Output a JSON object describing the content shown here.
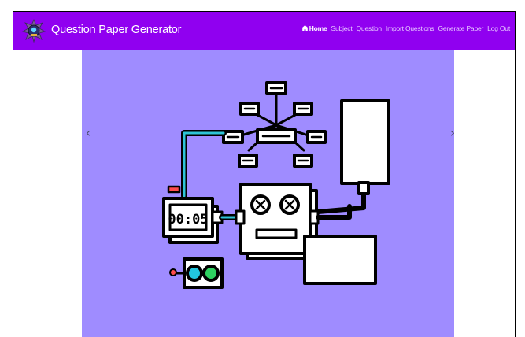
{
  "app": {
    "title": "Question Paper Generator"
  },
  "navbar": {
    "background_color": "#9000f0",
    "logo_icon": "robot-crest-icon",
    "items": [
      {
        "label": "Home",
        "icon": "home-icon",
        "active": true
      },
      {
        "label": "Subject"
      },
      {
        "label": "Question"
      },
      {
        "label": "Import Questions"
      },
      {
        "label": "Generate Paper"
      },
      {
        "label": "Log Out"
      }
    ]
  },
  "carousel": {
    "background_color": "#9f8cff",
    "prev_label": "‹",
    "next_label": "›",
    "illustration": {
      "timer_display": "00:05",
      "accent_cable_color": "#2ec4d6",
      "indicator_colors": [
        "#22c6e0",
        "#2ed160"
      ],
      "pin_color": "#ff4d4d"
    }
  }
}
